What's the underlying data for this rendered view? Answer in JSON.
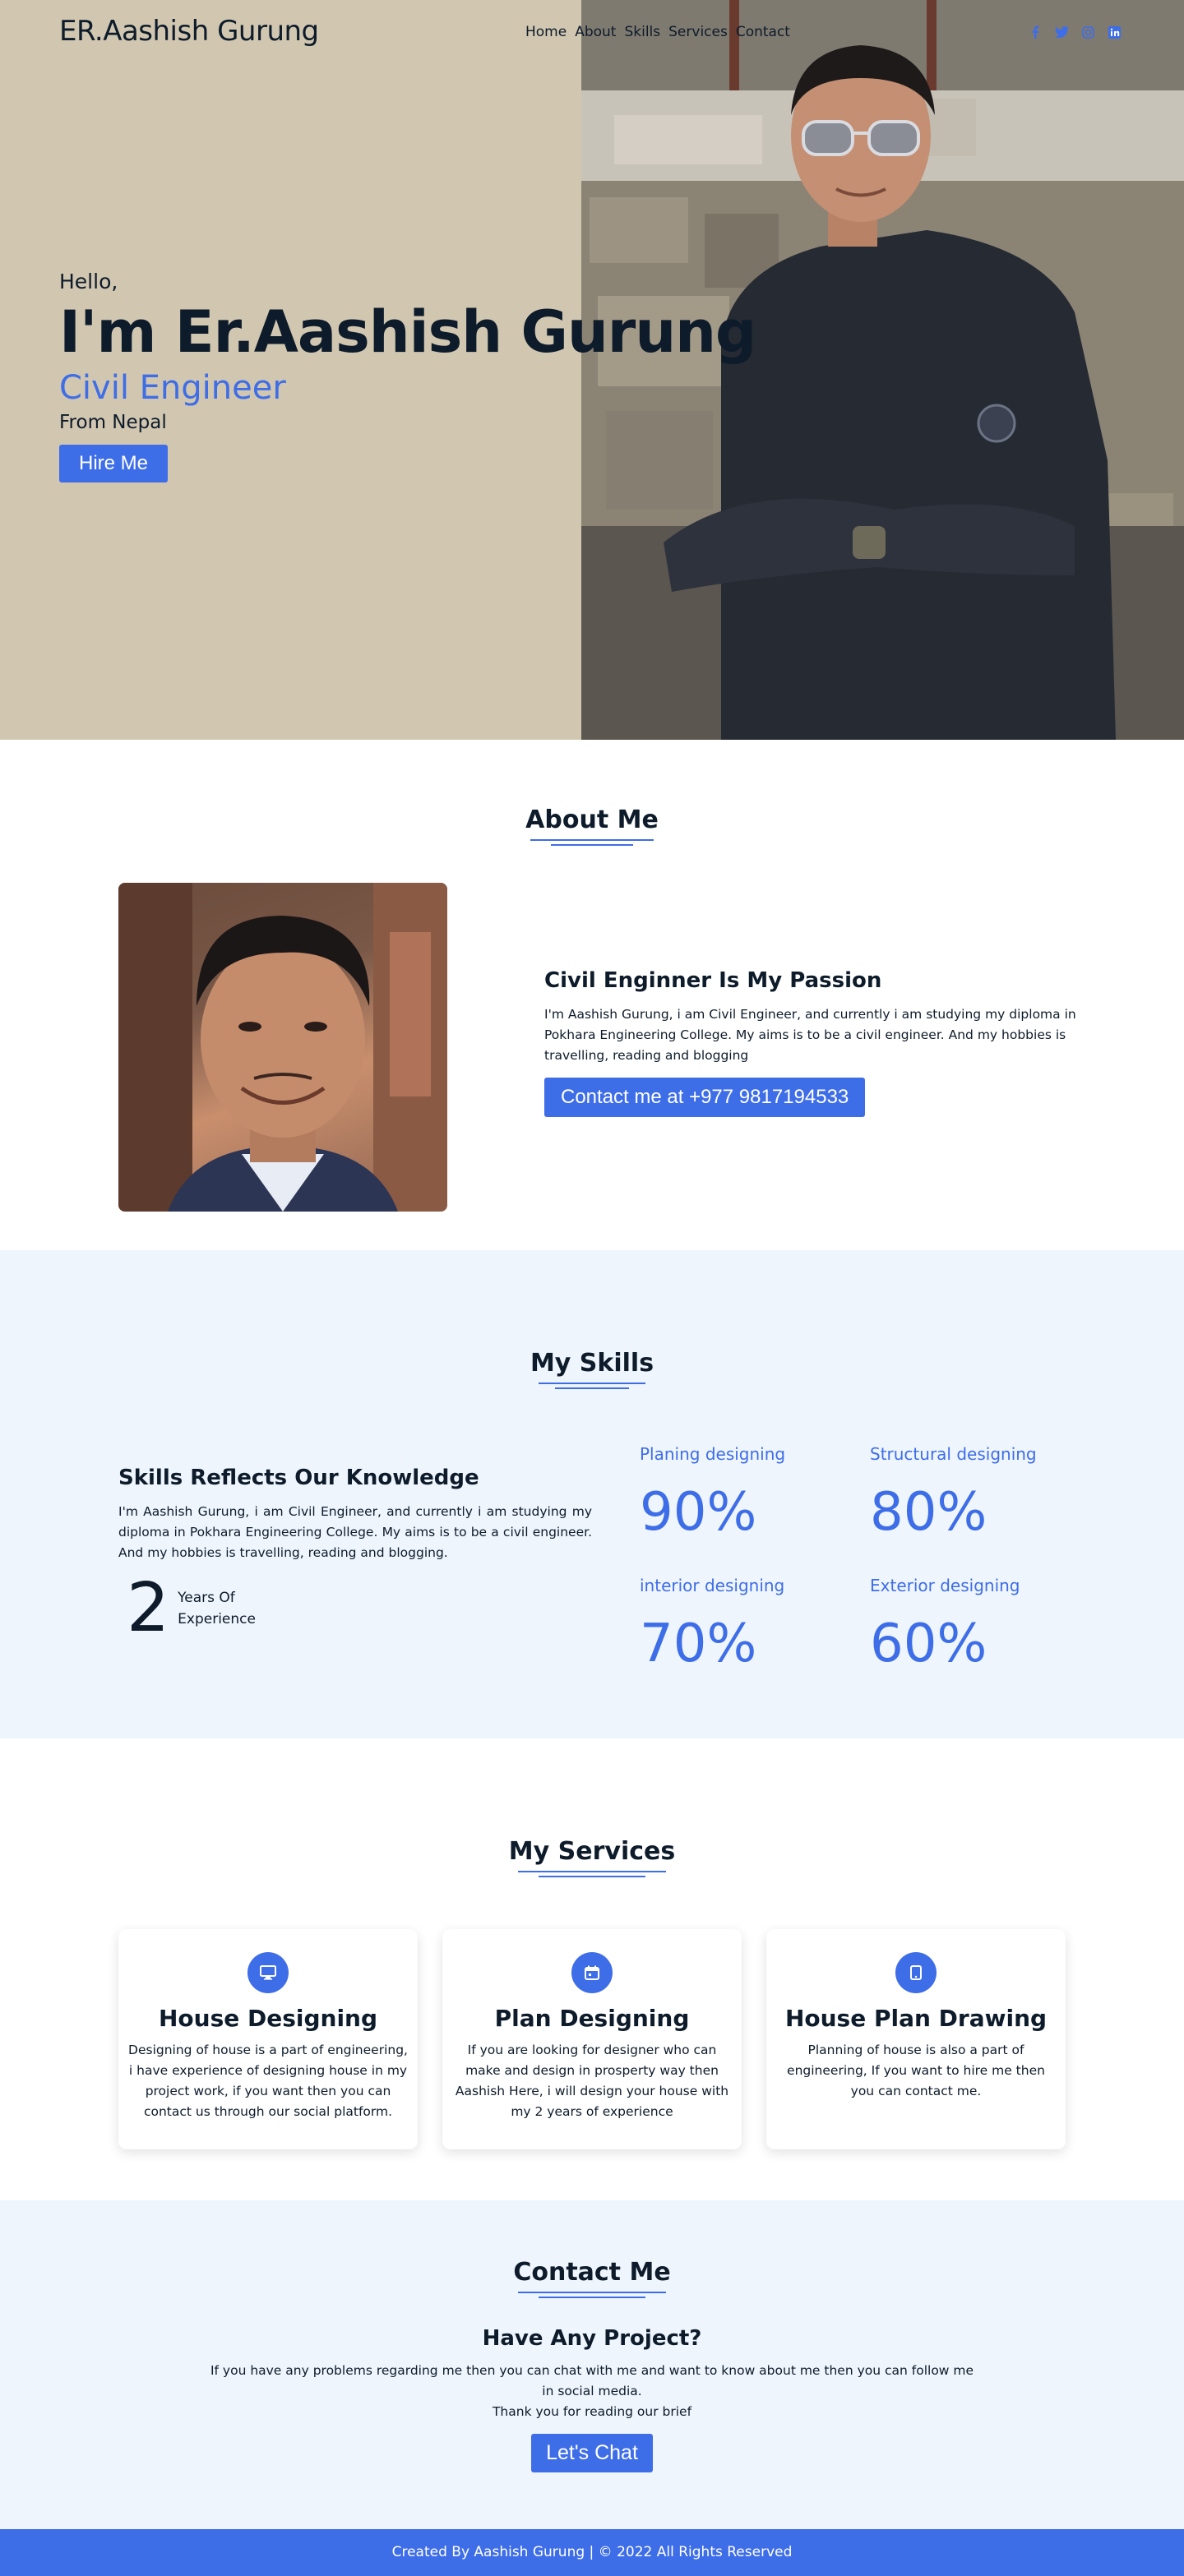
{
  "nav": {
    "brand": "ER.Aashish Gurung",
    "links": [
      "Home",
      "About",
      "Skills",
      "Services",
      "Contact"
    ],
    "social_icons": [
      "facebook-icon",
      "twitter-icon",
      "instagram-icon",
      "linkedin-icon"
    ]
  },
  "hero": {
    "greeting": "Hello,",
    "name": "I'm Er.Aashish Gurung",
    "role": "Civil Engineer",
    "from": "From Nepal",
    "hire_label": "Hire Me"
  },
  "about": {
    "title": "About Me",
    "subtitle": "Civil Enginner Is My Passion",
    "paragraph": "I'm Aashish Gurung, i am Civil Engineer, and currently i am studying my diploma in Pokhara Engineering College. My aims is to be a civil engineer. And my hobbies is travelling, reading and blogging",
    "contact_label": "Contact me at +977 9817194533"
  },
  "skills": {
    "title": "My Skills",
    "subtitle": "Skills Reflects Our Knowledge",
    "paragraph": "I'm Aashish Gurung, i am Civil Engineer, and currently i am studying my diploma in Pokhara Engineering College. My aims is to be a civil engineer. And my hobbies is travelling, reading and blogging.",
    "years_number": "2",
    "years_line1": "Years Of",
    "years_line2": "Experience",
    "items": [
      {
        "name": "Planing designing",
        "value": "90%"
      },
      {
        "name": "Structural designing",
        "value": "80%"
      },
      {
        "name": "interior designing",
        "value": "70%"
      },
      {
        "name": "Exterior designing",
        "value": "60%"
      }
    ]
  },
  "services": {
    "title": "My Services",
    "cards": [
      {
        "icon": "monitor-icon",
        "title": "House Designing",
        "text": "Designing of house is a part of engineering, i have experience of designing house in my project work, if you want then you can contact us through our social platform."
      },
      {
        "icon": "calendar-icon",
        "title": "Plan Designing",
        "text": "If you are looking for designer who can make and design in prosperty way then Aashish Here, i will design your house with my 2 years of experience"
      },
      {
        "icon": "tablet-icon",
        "title": "House Plan Drawing",
        "text": "Planning of house is also a part of engineering, If you want to hire me then you can contact me."
      }
    ]
  },
  "contact": {
    "title": "Contact Me",
    "subtitle": "Have Any Project?",
    "paragraph": "If you have any problems regarding me then you can chat with me and want to know about me then you can follow me in social media.",
    "thanks": "Thank you for reading our brief",
    "chat_label": "Let's Chat"
  },
  "footer": {
    "prefix": "Created By",
    "author": "Aashish Gurung",
    "suffix": "| © 2022 All Rights Reserved"
  },
  "colors": {
    "accent": "#3e6de8",
    "hero_bg": "#d1c6b0",
    "tint_bg": "#eef5fd",
    "dark": "#0d1b2a"
  }
}
